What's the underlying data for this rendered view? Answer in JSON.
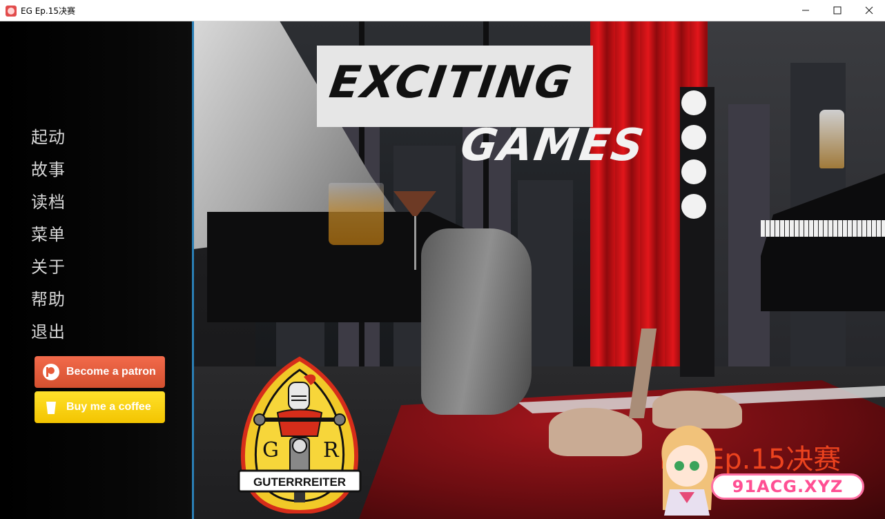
{
  "window": {
    "title": "EG Ep.15决赛",
    "controls": [
      "minimize",
      "maximize",
      "close"
    ]
  },
  "logo": {
    "line1": "EXCITING",
    "line2": "GAMES"
  },
  "menu": {
    "items": [
      {
        "label": "起动"
      },
      {
        "label": "故事"
      },
      {
        "label": "读档"
      },
      {
        "label": "菜单"
      },
      {
        "label": "关于"
      },
      {
        "label": "帮助"
      },
      {
        "label": "退出"
      }
    ]
  },
  "support": {
    "patron_label": "Become a patron",
    "coffee_label": "Buy me a coffee"
  },
  "badge": {
    "left_letter": "G",
    "right_letter": "R",
    "banner": "GUTERRREITER"
  },
  "version": {
    "text": "EG Ep.15决赛",
    "color": "#f4461f"
  },
  "watermark": {
    "text": "91ACG.XYZ"
  },
  "colors": {
    "sidebar_edge": "#2a7fb6",
    "patron": "#e85b3a",
    "coffee": "#ffdd00",
    "curtain": "#d8141a"
  }
}
